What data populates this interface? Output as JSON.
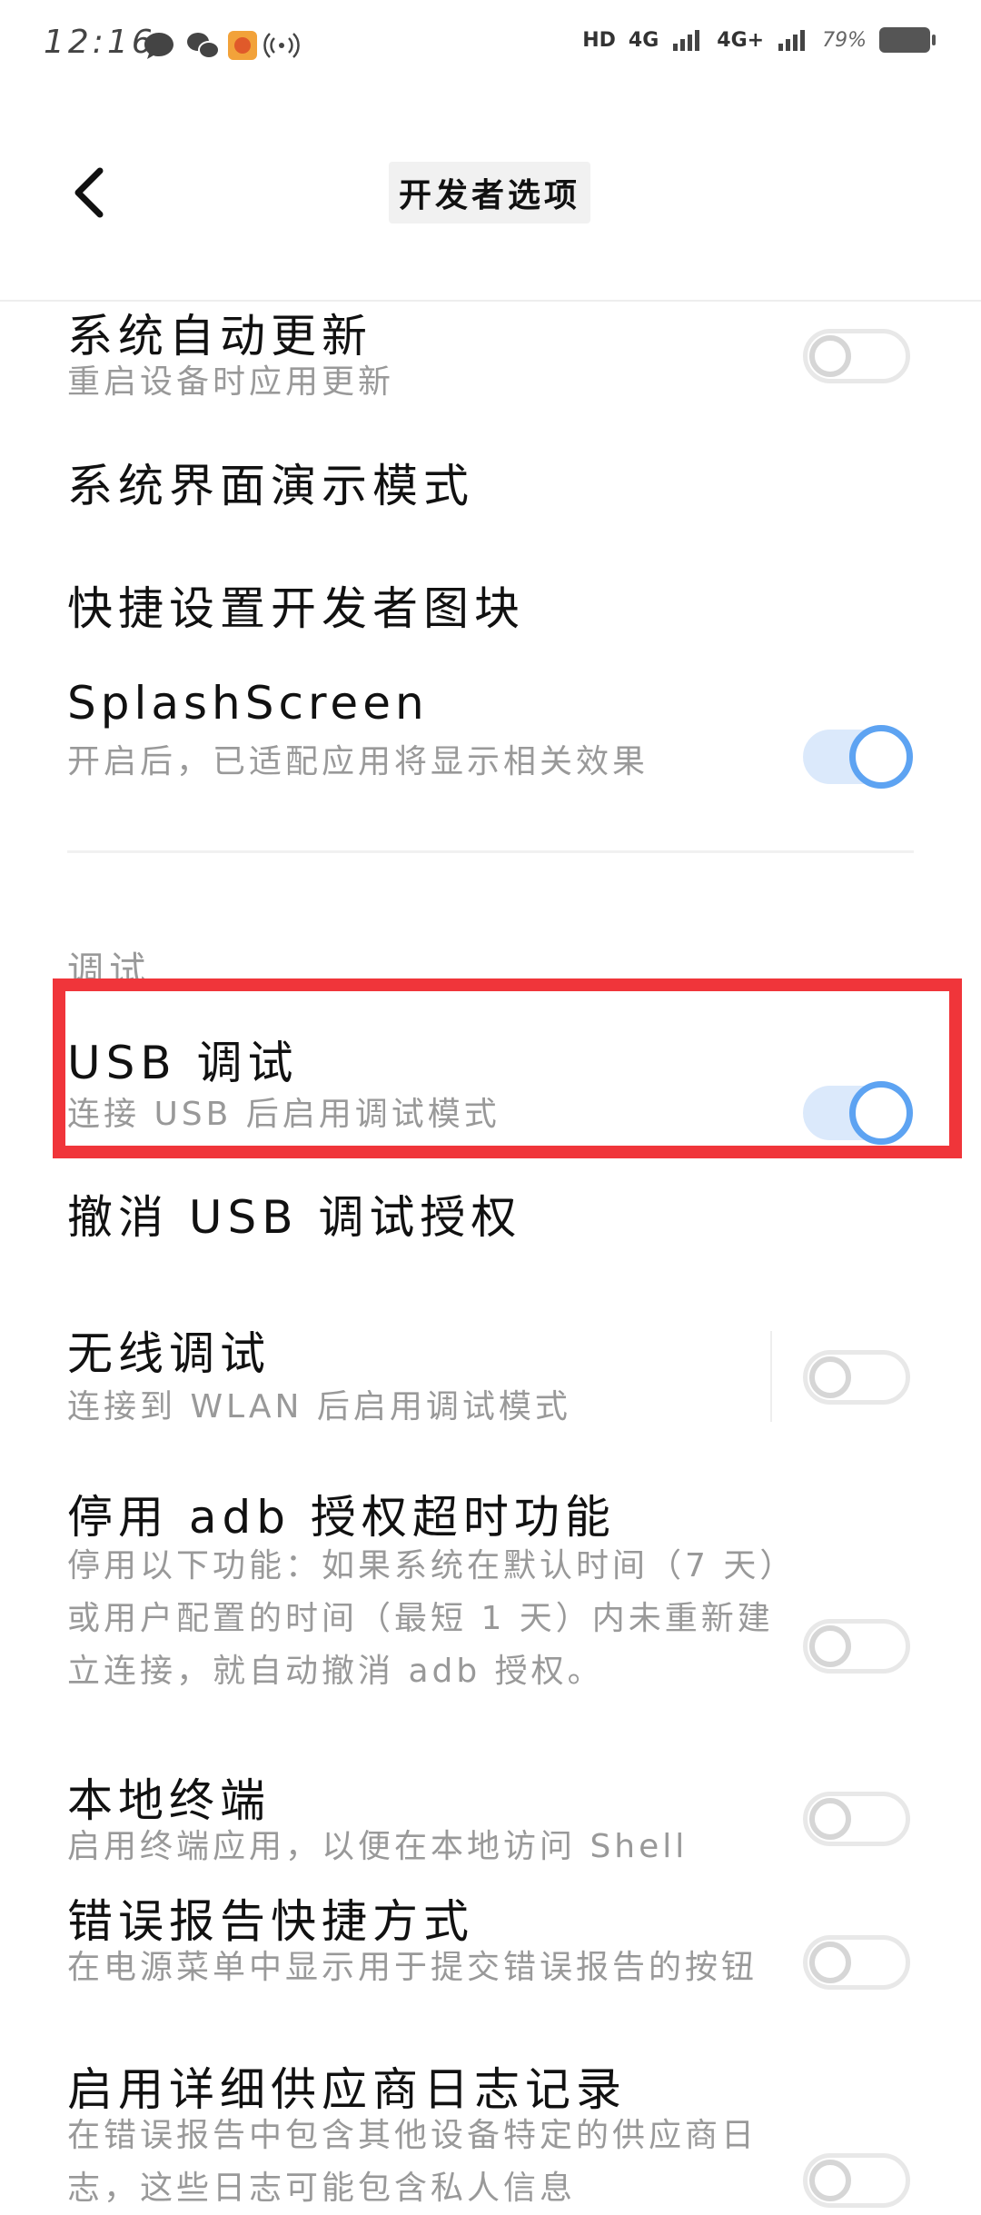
{
  "status_bar": {
    "time": "12:16",
    "network_labels": [
      "HD",
      "4G",
      "4G+"
    ],
    "battery": "79%"
  },
  "header": {
    "title": "开发者选项"
  },
  "settings": {
    "system_auto_update": {
      "title": "系统自动更新",
      "subtitle": "重启设备时应用更新",
      "enabled": false
    },
    "systemui_demo_mode": {
      "title": "系统界面演示模式"
    },
    "quick_settings_tiles": {
      "title": "快捷设置开发者图块"
    },
    "splash_screen": {
      "title": "SplashScreen",
      "subtitle": "开启后，已适配应用将显示相关效果",
      "enabled": true
    },
    "section_debug": "调试",
    "usb_debugging": {
      "title": "USB 调试",
      "subtitle": "连接 USB 后启用调试模式",
      "enabled": true
    },
    "revoke_usb_auth": {
      "title": "撤消 USB 调试授权"
    },
    "wireless_debugging": {
      "title": "无线调试",
      "subtitle": "连接到 WLAN 后启用调试模式",
      "enabled": false
    },
    "disable_adb_timeout": {
      "title": "停用 adb 授权超时功能",
      "subtitle": "停用以下功能：如果系统在默认时间（7 天）或用户配置的时间（最短 1 天）内未重新建立连接，就自动撤消 adb 授权。",
      "enabled": false
    },
    "local_terminal": {
      "title": "本地终端",
      "subtitle": "启用终端应用，以便在本地访问 Shell",
      "enabled": false
    },
    "bug_report_shortcut": {
      "title": "错误报告快捷方式",
      "subtitle": "在电源菜单中显示用于提交错误报告的按钮",
      "enabled": false
    },
    "verbose_vendor_logging": {
      "title": "启用详细供应商日志记录",
      "subtitle": "在错误报告中包含其他设备特定的供应商日志，这些日志可能包含私人信息",
      "enabled": false
    }
  },
  "colors": {
    "accent": "#5da3f2",
    "highlight": "#f0353a"
  }
}
